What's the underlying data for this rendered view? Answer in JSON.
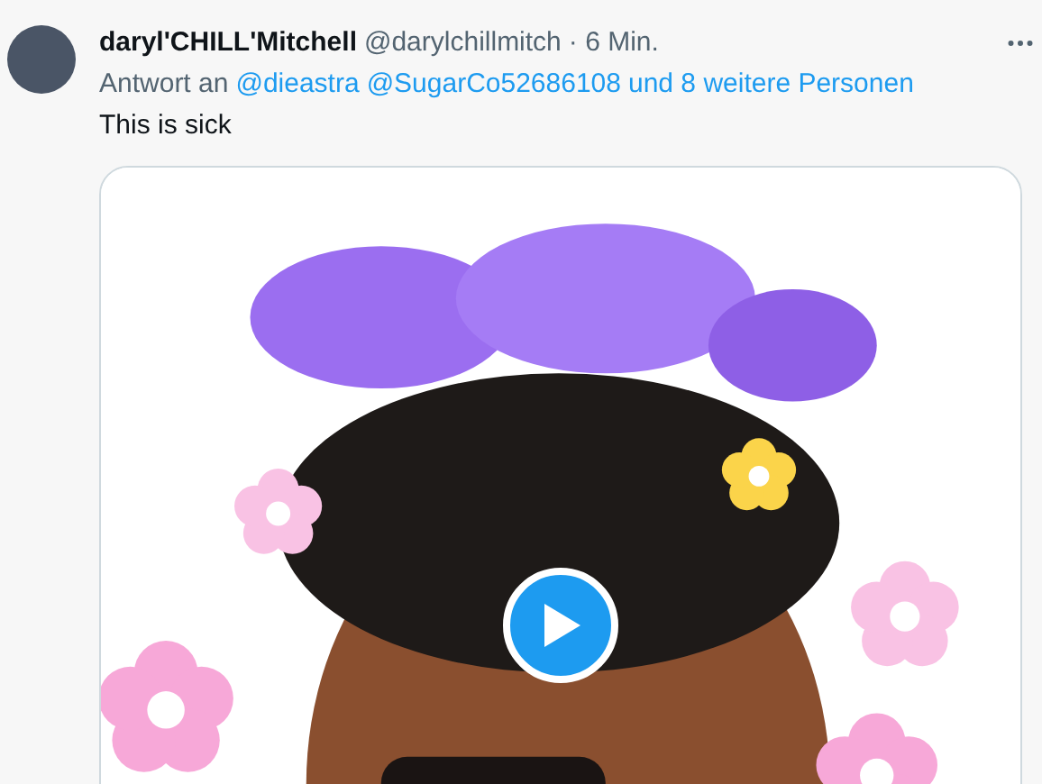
{
  "tweet": {
    "author": {
      "name": "daryl'CHILL'Mitchell",
      "handle": "@darylchillmitch",
      "time": "· 6 Min."
    },
    "reply_to": {
      "prefix": "Antwort an",
      "mentions": [
        "@dieastra",
        "@SugarCo52686108"
      ],
      "others": "und 8 weitere Personen"
    },
    "text": "This is sick",
    "media": {
      "kind": "picture",
      "video": true
    }
  }
}
